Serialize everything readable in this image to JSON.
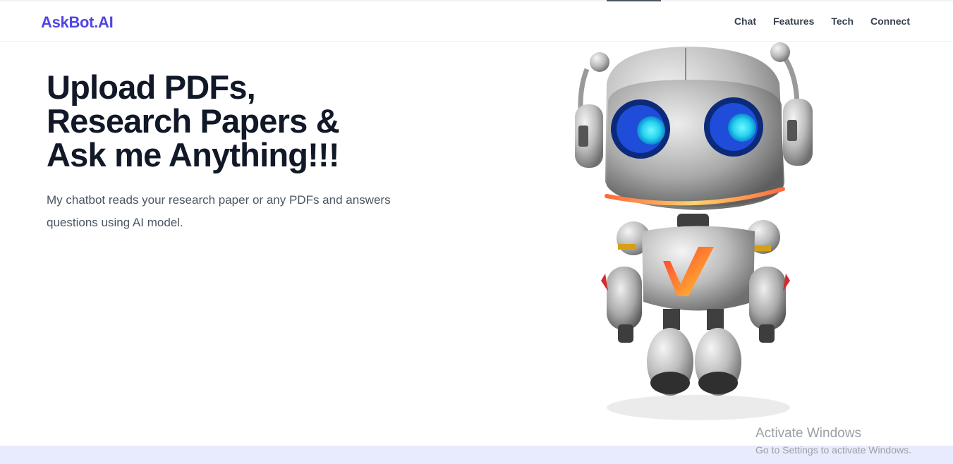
{
  "header": {
    "brand": "AskBot.AI",
    "nav": [
      "Chat",
      "Features",
      "Tech",
      "Connect"
    ]
  },
  "hero": {
    "title_lines": [
      "Upload PDFs,",
      "Research Papers &",
      "Ask me Anything!!!"
    ],
    "subtitle": "My chatbot reads your research paper or any PDFs and answers questions using AI model."
  },
  "watermark": {
    "title": "Activate Windows",
    "subtitle": "Go to Settings to activate Windows."
  },
  "colors": {
    "brand": "#4f46e5",
    "heading": "#111827",
    "body": "#4b5563",
    "band": "#e8ebfd",
    "robot_eye": "#3ee8f5",
    "robot_smile": "#ffb347"
  },
  "icons": [
    "robot-mascot-image"
  ]
}
